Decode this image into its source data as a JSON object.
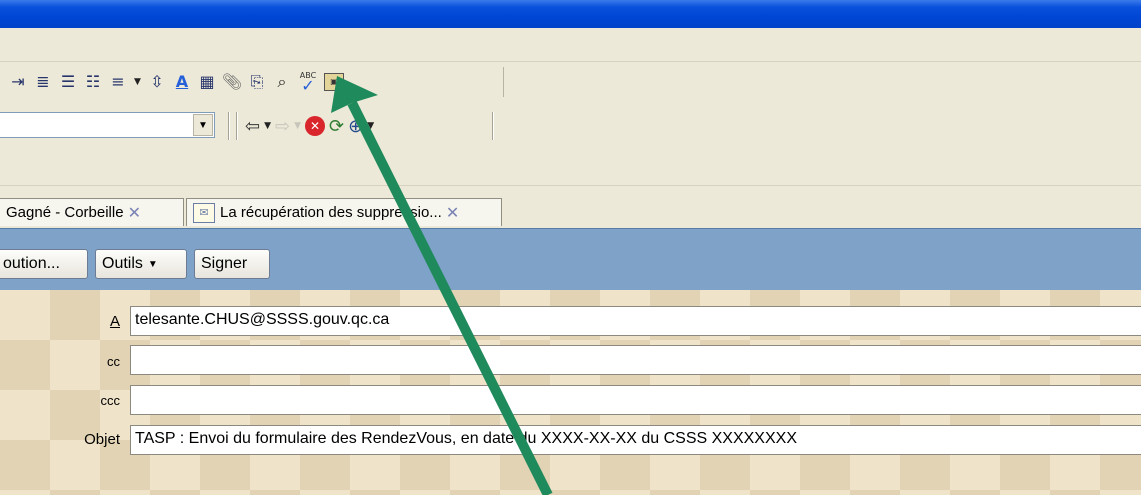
{
  "toolbar_format": {
    "icons": [
      "indent-icon",
      "decrease-indent-icon",
      "bullets-icon",
      "numbering-icon",
      "align-icon",
      "align-dropdown-icon",
      "line-spacing-icon",
      "font-color-icon",
      "table-icon",
      "attach-icon",
      "insert-file-icon",
      "find-icon",
      "spell-check-icon",
      "image-icon"
    ]
  },
  "toolbar_nav": {
    "address_value": "",
    "icons": [
      "back-icon",
      "back-dropdown-icon",
      "forward-icon",
      "forward-dropdown-icon",
      "stop-icon",
      "refresh-icon",
      "zoom-icon",
      "zoom-dropdown-icon"
    ]
  },
  "tabs": [
    {
      "label": "Gagné - Corbeille"
    },
    {
      "label": "La récupération des suppressio..."
    }
  ],
  "actions": {
    "distribution_label": "oution...",
    "tools_label": "Outils",
    "sign_label": "Signer"
  },
  "compose": {
    "to_label": "A",
    "to_value": "telesante.CHUS@SSSS.gouv.qc.ca",
    "cc_label": "cc",
    "cc_value": "",
    "bcc_label": "ccc",
    "bcc_value": "",
    "subject_label": "Objet",
    "subject_value": "TASP : Envoi du formulaire des RendezVous, en date du XXXX-XX-XX du CSSS XXXXXXXX"
  },
  "annotation": {
    "arrow_color": "#1f8a5b",
    "points_to": "attach-icon"
  }
}
